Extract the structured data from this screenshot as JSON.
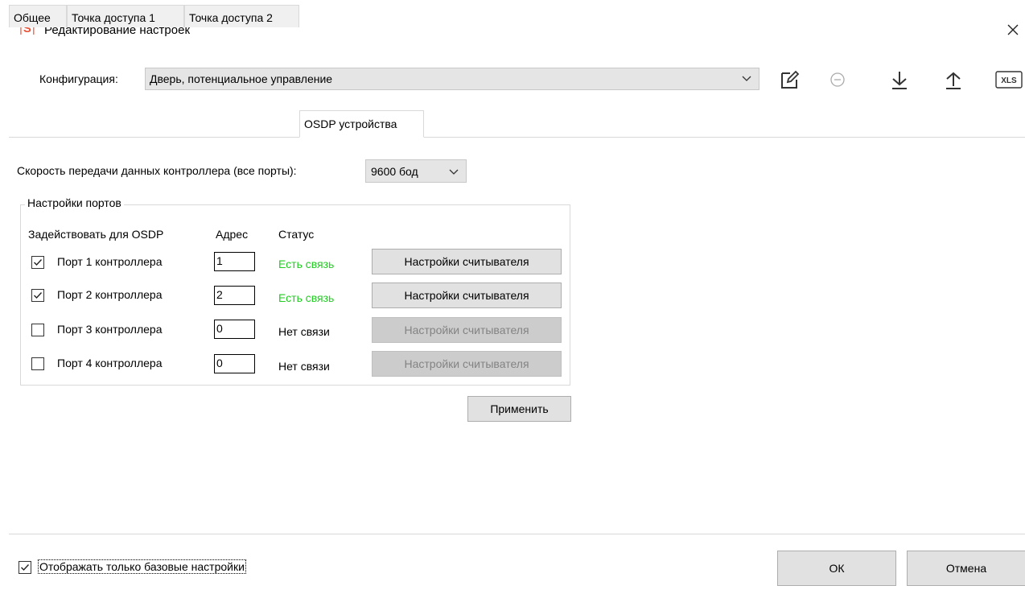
{
  "window": {
    "logo": "S",
    "title": "Редактирование настроек"
  },
  "config": {
    "label": "Конфигурация:",
    "value": "Дверь, потенциальное управление"
  },
  "toolbar": {
    "xls_label": "XLS"
  },
  "tabs": [
    {
      "label": "Общее",
      "active": false
    },
    {
      "label": "Точка доступа 1",
      "active": false
    },
    {
      "label": "Точка доступа 2",
      "active": false
    },
    {
      "label": "OSDP устройства",
      "active": true
    }
  ],
  "speed": {
    "label": "Скорость передачи данных контроллера (все порты):",
    "value": "9600 бод"
  },
  "ports": {
    "group_title": "Настройки портов",
    "headers": {
      "use": "Задействовать для OSDP",
      "address": "Адрес",
      "status": "Статус"
    },
    "rows": [
      {
        "label": "Порт 1 контроллера",
        "checked": true,
        "address": "1",
        "status": "Есть связь",
        "connected": true,
        "button": "Настройки считывателя"
      },
      {
        "label": "Порт 2 контроллера",
        "checked": true,
        "address": "2",
        "status": "Есть связь",
        "connected": true,
        "button": "Настройки считывателя"
      },
      {
        "label": "Порт 3 контроллера",
        "checked": false,
        "address": "0",
        "status": "Нет связи",
        "connected": false,
        "button": "Настройки считывателя"
      },
      {
        "label": "Порт 4 контроллера",
        "checked": false,
        "address": "0",
        "status": "Нет связи",
        "connected": false,
        "button": "Настройки считывателя"
      }
    ],
    "apply": "Применить"
  },
  "footer": {
    "basic_only_label": "Отображать только базовые настройки",
    "basic_only_checked": true,
    "ok": "ОК",
    "cancel": "Отмена"
  },
  "colors": {
    "logo": "#e8553a",
    "status_ok": "#22cc22",
    "button_bg": "#e1e1e1",
    "button_disabled_bg": "#cccccc"
  }
}
